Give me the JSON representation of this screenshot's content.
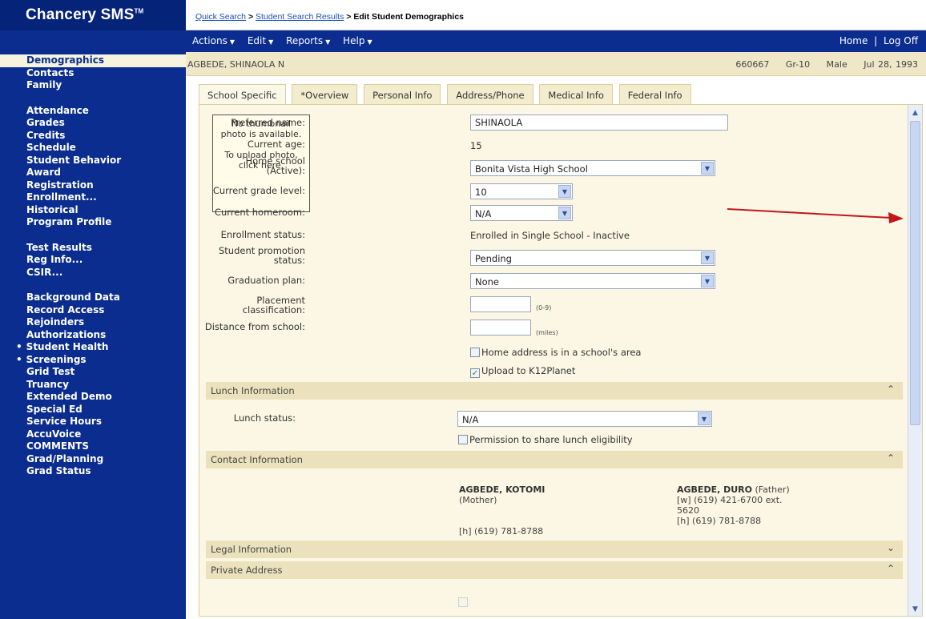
{
  "app": {
    "logo": "Chancery SMS",
    "trademark": "TM"
  },
  "breadcrumb": {
    "items": [
      "Quick Search",
      "Student Search Results"
    ],
    "separator": ">",
    "current": "Edit Student Demographics"
  },
  "menubar": {
    "menus": [
      "Actions",
      "Edit",
      "Reports",
      "Help"
    ],
    "home": "Home",
    "divider": "|",
    "logoff": "Log Off"
  },
  "sidebar": {
    "active": "Demographics",
    "group1": [
      "Contacts",
      "Family"
    ],
    "group2": [
      "Attendance",
      "Grades",
      "Credits",
      "Schedule",
      "Student Behavior",
      "Award",
      "Registration",
      "Enrollment...",
      "Historical",
      "Program Profile"
    ],
    "group3": [
      "Test Results",
      "Reg Info...",
      "CSIR..."
    ],
    "group4": [
      "Background Data",
      "Record Access",
      "Rejoinders",
      "Authorizations"
    ],
    "bulleted": [
      "Student Health",
      "Screenings"
    ],
    "group5": [
      "Grid Test",
      "Truancy",
      "Extended Demo",
      "Special Ed",
      "Service Hours",
      "AccuVoice",
      "COMMENTS",
      "Grad/Planning",
      "Grad Status"
    ]
  },
  "student": {
    "name": "AGBEDE, SHINAOLA N",
    "id": "660667",
    "grade": "Gr-10",
    "gender": "Male",
    "dob": "Jul 28, 1993"
  },
  "tabs": [
    "School Specific",
    "*Overview",
    "Personal Info",
    "Address/Phone",
    "Medical Info",
    "Federal Info"
  ],
  "photo": {
    "line1": "No thumbnail photo is available.",
    "line2": "To upload photo, click here."
  },
  "form": {
    "preferred_name": {
      "label": "Preferred name:",
      "value": "SHINAOLA"
    },
    "current_age": {
      "label": "Current age:",
      "value": "15"
    },
    "home_school": {
      "label1": "Home school",
      "label2": "(Active):",
      "value": "Bonita Vista High School"
    },
    "grade_level": {
      "label": "Current grade level:",
      "value": "10"
    },
    "homeroom": {
      "label": "Current homeroom:",
      "value": "N/A"
    },
    "enrollment_status": {
      "label": "Enrollment status:",
      "value": "Enrolled in Single School - Inactive"
    },
    "promotion_status": {
      "label1": "Student promotion",
      "label2": "status:",
      "value": "Pending"
    },
    "graduation_plan": {
      "label": "Graduation plan:",
      "value": "None"
    },
    "placement": {
      "label1": "Placement",
      "label2": "classification:",
      "value": "",
      "hint": "(0-9)"
    },
    "distance": {
      "label": "Distance from school:",
      "value": "",
      "hint": "(miles)"
    },
    "home_address_check": {
      "label": "Home address is in a school's area",
      "checked": false
    },
    "k12planet_check": {
      "label": "Upload to K12Planet",
      "checked": true
    }
  },
  "lunch": {
    "section_title": "Lunch Information",
    "status_label": "Lunch status:",
    "status_value": "N/A",
    "share_label": "Permission to share lunch eligibility"
  },
  "contact_section": {
    "title": "Contact Information",
    "contacts": [
      {
        "name": "AGBEDE, KOTOMI",
        "relation": "(Mother)",
        "phone1": "",
        "phone2": "",
        "phone3": "[h] (619) 781-8788"
      },
      {
        "name": "AGBEDE, DURO",
        "relation": "(Father)",
        "phone1": "[w] (619) 421-6700 ext.",
        "phone2": "5620",
        "phone3": "[h] (619) 781-8788"
      }
    ]
  },
  "legal_section": {
    "title": "Legal Information"
  },
  "private_section": {
    "title": "Private Address"
  },
  "colors": {
    "nav_blue": "#0a2d8f",
    "panel_bg": "#fbf7e4",
    "section_bg": "#ebe2bd",
    "arrow_red": "#c0171d"
  }
}
